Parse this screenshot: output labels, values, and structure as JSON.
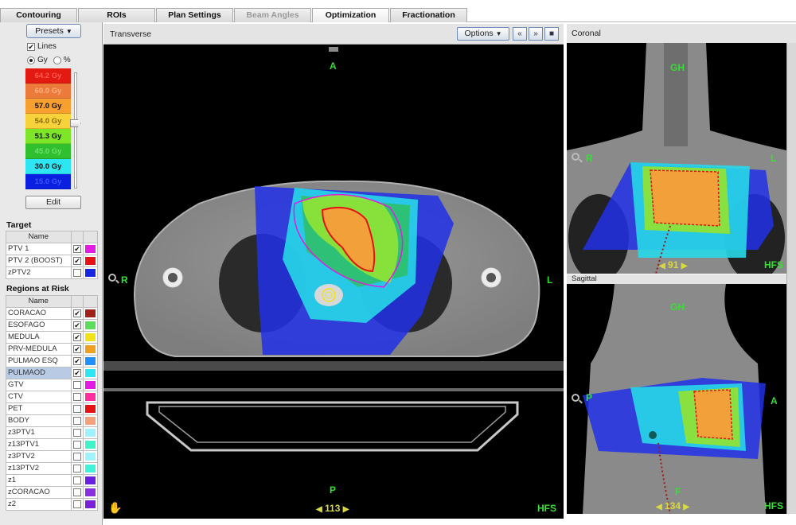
{
  "tabs": [
    {
      "label": "Contouring",
      "state": "normal"
    },
    {
      "label": "ROIs",
      "state": "normal"
    },
    {
      "label": "Plan Settings",
      "state": "normal"
    },
    {
      "label": "Beam Angles",
      "state": "disabled"
    },
    {
      "label": "Optimization",
      "state": "active"
    },
    {
      "label": "Fractionation",
      "state": "normal"
    }
  ],
  "dose_panel": {
    "presets_label": "Presets",
    "lines_label": "Lines",
    "lines_checked": true,
    "unit_gy_label": "Gy",
    "unit_pct_label": "%",
    "selected_unit": "Gy",
    "edit_label": "Edit",
    "levels": [
      {
        "label": "64.2 Gy",
        "color": "#e31a12",
        "text_color": "#ff5a50"
      },
      {
        "label": "60.0 Gy",
        "color": "#ec7a3a",
        "text_color": "#ffb080"
      },
      {
        "label": "57.0 Gy",
        "color": "#f7a030",
        "text_color": "#111111"
      },
      {
        "label": "54.0 Gy",
        "color": "#f7d23a",
        "text_color": "#8a6d00"
      },
      {
        "label": "51.3 Gy",
        "color": "#7ee628",
        "text_color": "#111111"
      },
      {
        "label": "45.0 Gy",
        "color": "#2fbf2f",
        "text_color": "#6fe06f"
      },
      {
        "label": "30.0 Gy",
        "color": "#2ee6f2",
        "text_color": "#111111"
      },
      {
        "label": "15.0 Gy",
        "color": "#0a1fe0",
        "text_color": "#3e55ff"
      }
    ]
  },
  "target": {
    "title": "Target",
    "name_header": "Name",
    "rows": [
      {
        "name": "PTV 1",
        "checked": true,
        "color": "#e21be2"
      },
      {
        "name": "PTV 2 (BOOST)",
        "checked": true,
        "color": "#e41212"
      },
      {
        "name": "zPTV2",
        "checked": false,
        "color": "#1426e0"
      }
    ]
  },
  "regions": {
    "title": "Regions at Risk",
    "name_header": "Name",
    "rows": [
      {
        "name": "CORACAO",
        "checked": true,
        "color": "#a0201a"
      },
      {
        "name": "ESOFAGO",
        "checked": true,
        "color": "#5edc5e"
      },
      {
        "name": "MEDULA",
        "checked": true,
        "color": "#f2e21a"
      },
      {
        "name": "PRV-MEDULA",
        "checked": true,
        "color": "#f0a020"
      },
      {
        "name": "PULMAO ESQ",
        "checked": true,
        "color": "#1e90ff"
      },
      {
        "name": "PULMAOD",
        "checked": true,
        "color": "#2ee6f2",
        "selected": true
      },
      {
        "name": "GTV",
        "checked": false,
        "color": "#e21be2"
      },
      {
        "name": "CTV",
        "checked": false,
        "color": "#ff2fa0"
      },
      {
        "name": "PET",
        "checked": false,
        "color": "#e41212"
      },
      {
        "name": "BODY",
        "checked": false,
        "color": "#f4a07a"
      },
      {
        "name": "z3PTV1",
        "checked": false,
        "color": "#9ff2ff"
      },
      {
        "name": "z13PTV1",
        "checked": false,
        "color": "#3ff2c8"
      },
      {
        "name": "z3PTV2",
        "checked": false,
        "color": "#9ff2ff"
      },
      {
        "name": "z13PTV2",
        "checked": false,
        "color": "#3ff2d8"
      },
      {
        "name": "z1",
        "checked": false,
        "color": "#6a1fe0"
      },
      {
        "name": "zCORACAO",
        "checked": false,
        "color": "#8a2fe0"
      },
      {
        "name": "z2",
        "checked": false,
        "color": "#7a20d8"
      }
    ]
  },
  "transverse": {
    "title": "Transverse",
    "options_label": "Options",
    "nav_prev": "«",
    "nav_next": "»",
    "label_anterior": "A",
    "label_posterior": "P",
    "label_right": "R",
    "label_left": "L",
    "orientation": "HFS",
    "slice": "113",
    "slice_prev": "◀",
    "slice_next": "▶"
  },
  "coronal": {
    "title": "Coronal",
    "label_top": "GH",
    "label_right": "R",
    "label_left": "L",
    "orientation": "HFS",
    "slice": "91",
    "slice_prev": "◀",
    "slice_next": "▶"
  },
  "sagittal": {
    "title": "Sagittal",
    "label_top": "GH",
    "label_posterior": "P",
    "label_anterior": "A",
    "label_bottom": "F",
    "orientation": "HFS",
    "slice": "134",
    "slice_prev": "◀",
    "slice_next": "▶"
  }
}
